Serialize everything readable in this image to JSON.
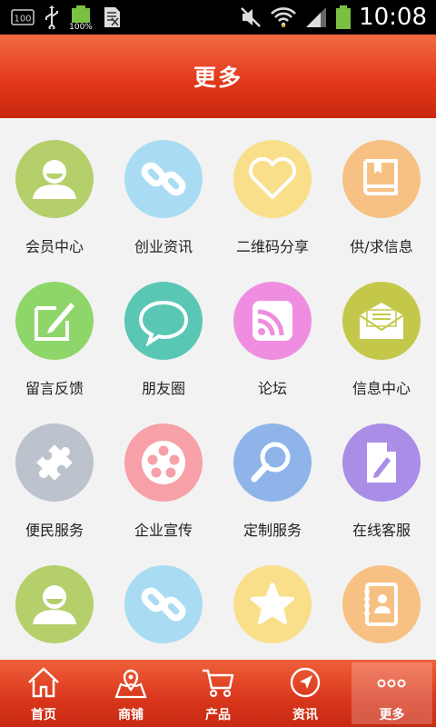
{
  "status_bar": {
    "icons": [
      "sim-100-icon",
      "usb-icon",
      "battery-small-icon",
      "sd-card-icon",
      "mute-icon",
      "wifi-icon",
      "signal-icon",
      "battery-icon"
    ],
    "battery_small_text": "100%",
    "sim_text": "100",
    "time": "10:08"
  },
  "header": {
    "title": "更多"
  },
  "grid": {
    "items": [
      {
        "label": "会员中心",
        "icon": "member-icon",
        "color": "#b5cf6a"
      },
      {
        "label": "创业资讯",
        "icon": "link-icon",
        "color": "#a9dcf3"
      },
      {
        "label": "二维码分享",
        "icon": "heart-icon",
        "color": "#f9df8a"
      },
      {
        "label": "供/求信息",
        "icon": "book-icon",
        "color": "#f7c184"
      },
      {
        "label": "留言反馈",
        "icon": "edit-icon",
        "color": "#8fd66a"
      },
      {
        "label": "朋友圈",
        "icon": "chat-icon",
        "color": "#5ac7b5"
      },
      {
        "label": "论坛",
        "icon": "rss-icon",
        "color": "#ef8ee0"
      },
      {
        "label": "信息中心",
        "icon": "mail-icon",
        "color": "#c4c84a"
      },
      {
        "label": "便民服务",
        "icon": "puzzle-icon",
        "color": "#bcc3cd"
      },
      {
        "label": "企业宣传",
        "icon": "film-reel-icon",
        "color": "#f7a0a8"
      },
      {
        "label": "定制服务",
        "icon": "magnifier-icon",
        "color": "#8fb4ea"
      },
      {
        "label": "在线客服",
        "icon": "document-edit-icon",
        "color": "#a98de6"
      },
      {
        "label": "",
        "icon": "member-icon",
        "color": "#b5cf6a"
      },
      {
        "label": "",
        "icon": "link-icon",
        "color": "#a9dcf3"
      },
      {
        "label": "",
        "icon": "star-icon",
        "color": "#f9df8a"
      },
      {
        "label": "",
        "icon": "contacts-icon",
        "color": "#f7c184"
      }
    ]
  },
  "tabbar": {
    "tabs": [
      {
        "label": "首页",
        "icon": "home-icon"
      },
      {
        "label": "商铺",
        "icon": "map-pin-icon"
      },
      {
        "label": "产品",
        "icon": "cart-icon"
      },
      {
        "label": "资讯",
        "icon": "compass-icon"
      },
      {
        "label": "更多",
        "icon": "more-icon"
      }
    ],
    "active": "更多"
  }
}
